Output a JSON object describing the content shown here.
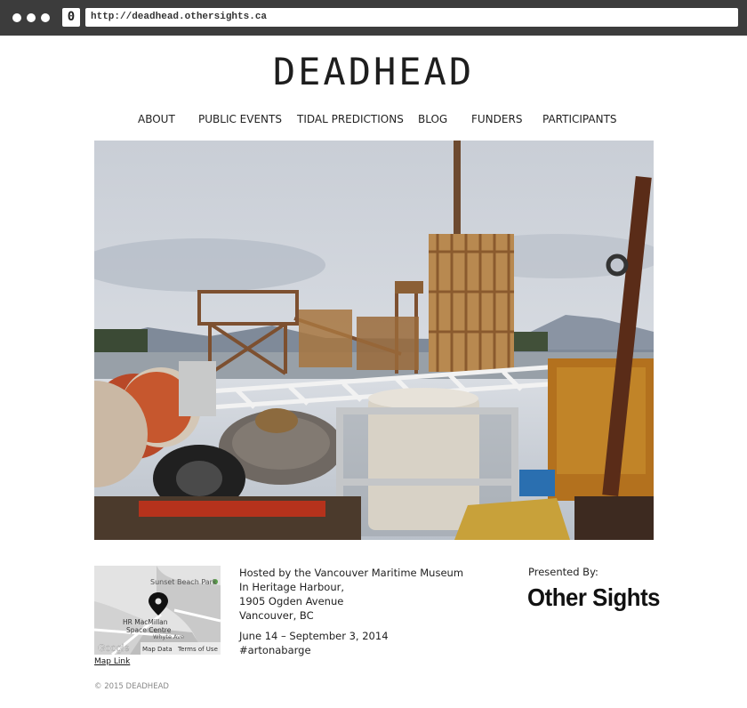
{
  "browser": {
    "tab_count": "0",
    "url": "http://deadhead.othersights.ca"
  },
  "site": {
    "logo": "DEADHEAD",
    "nav": [
      {
        "label": "ABOUT"
      },
      {
        "label": "PUBLIC EVENTS"
      },
      {
        "label": "TIDAL PREDICTIONS"
      },
      {
        "label": "BLOG"
      },
      {
        "label": "FUNDERS"
      },
      {
        "label": "PARTICIPANTS"
      }
    ],
    "hero": {
      "icon": "harbour-barge-photo"
    },
    "map": {
      "labels": {
        "park": "Sunset Beach Park",
        "centre_1": "HR MacMillan",
        "centre_2": "Space Centre",
        "street": "Whyte Ave",
        "google": "Google",
        "map_data": "Map Data",
        "terms": "Terms of Use"
      },
      "link": "Map Link"
    },
    "info": {
      "line1": "Hosted by the Vancouver Maritime Museum",
      "line2": "In Heritage Harbour,",
      "line3": "1905 Ogden Avenue",
      "line4": "Vancouver, BC",
      "dates": "June 14 – September 3, 2014",
      "hashtag": "#artonabarge"
    },
    "presented_by": "Presented By:",
    "presenter": "Other Sights",
    "copyright": "© 2015 DEADHEAD"
  }
}
